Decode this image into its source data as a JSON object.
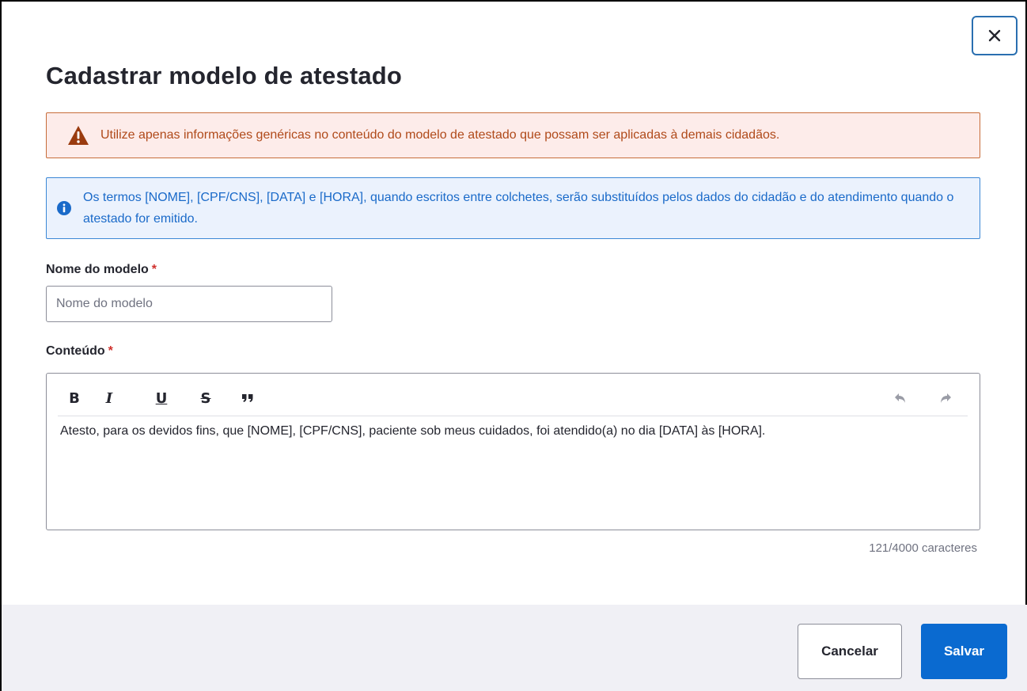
{
  "modal": {
    "title": "Cadastrar modelo de atestado",
    "close_icon": "close-icon"
  },
  "alerts": {
    "warning": {
      "icon": "warning-triangle-icon",
      "text": "Utilize apenas informações genéricas no conteúdo do modelo de atestado que possam ser aplicadas à demais cidadãos."
    },
    "info": {
      "icon": "info-circle-icon",
      "text": "Os termos [NOME], [CPF/CNS], [DATA] e [HORA], quando escritos entre colchetes, serão substituídos pelos dados do cidadão e do atendimento quando o atestado for emitido."
    }
  },
  "form": {
    "name_label": "Nome do modelo",
    "name_required": "*",
    "name_placeholder": "Nome do modelo",
    "name_value": "",
    "content_label": "Conteúdo",
    "content_required": "*",
    "toolbar": {
      "bold": "B",
      "italic": "I",
      "underline": "U",
      "strikethrough": "S",
      "quote_icon": "quote-icon",
      "undo_icon": "undo-icon",
      "redo_icon": "redo-icon"
    },
    "content_value": "Atesto, para os devidos fins, que [NOME], [CPF/CNS], paciente sob meus cuidados, foi atendido(a) no dia [DATA] às [HORA].",
    "counter": "121/4000 caracteres"
  },
  "footer": {
    "cancel_label": "Cancelar",
    "save_label": "Salvar"
  },
  "colors": {
    "primary": "#0a6ad0",
    "warning_bg": "#fdecea",
    "warning_text": "#b04a1a",
    "info_bg": "#ebf2fd",
    "info_text": "#1a6ac9",
    "required": "#d0302c"
  }
}
